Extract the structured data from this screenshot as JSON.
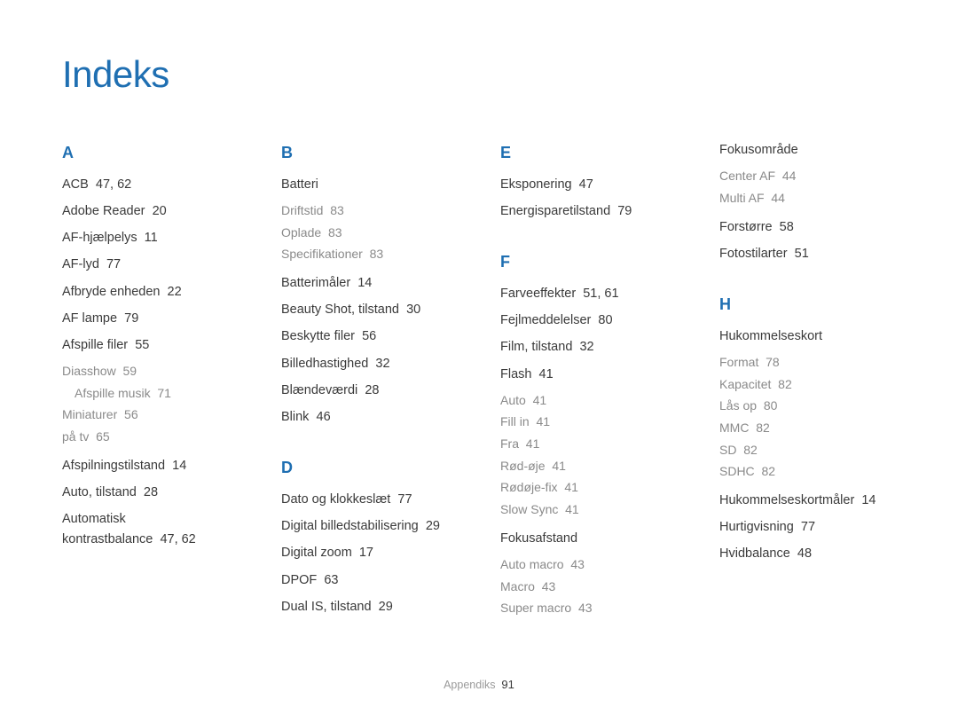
{
  "title": "Indeks",
  "footer": {
    "section": "Appendiks",
    "page": "91"
  },
  "columns": [
    [
      {
        "type": "letter",
        "text": "A"
      },
      {
        "type": "entry",
        "term": "ACB",
        "pages": "47, 62"
      },
      {
        "type": "entry",
        "term": "Adobe Reader",
        "pages": "20"
      },
      {
        "type": "entry",
        "term": "AF-hjælpelys",
        "pages": "11"
      },
      {
        "type": "entry",
        "term": "AF-lyd",
        "pages": "77"
      },
      {
        "type": "entry",
        "term": "Afbryde enheden",
        "pages": "22"
      },
      {
        "type": "entry",
        "term": "AF lampe",
        "pages": "79"
      },
      {
        "type": "entry",
        "term": "Afspille filer",
        "pages": "55"
      },
      {
        "type": "sub",
        "term": "Diasshow",
        "pages": "59",
        "indent": 0
      },
      {
        "type": "sub",
        "term": "Afspille musik",
        "pages": "71",
        "indent": 1
      },
      {
        "type": "sub",
        "term": "Miniaturer",
        "pages": "56",
        "indent": 0
      },
      {
        "type": "sub",
        "term": "på tv",
        "pages": "65",
        "indent": 0
      },
      {
        "type": "entry",
        "term": "Afspilningstilstand",
        "pages": "14",
        "topgap": true
      },
      {
        "type": "entry",
        "term": "Auto, tilstand",
        "pages": "28"
      },
      {
        "type": "entry",
        "term": "Automatisk kontrastbalance",
        "pages": "47, 62"
      }
    ],
    [
      {
        "type": "letter",
        "text": "B"
      },
      {
        "type": "entry",
        "term": "Batteri",
        "pages": ""
      },
      {
        "type": "sub",
        "term": "Driftstid",
        "pages": "83"
      },
      {
        "type": "sub",
        "term": "Oplade",
        "pages": "83"
      },
      {
        "type": "sub",
        "term": "Specifikationer",
        "pages": "83"
      },
      {
        "type": "entry",
        "term": "Batterimåler",
        "pages": "14",
        "topgap": true
      },
      {
        "type": "entry",
        "term": "Beauty Shot, tilstand",
        "pages": "30"
      },
      {
        "type": "entry",
        "term": "Beskytte filer",
        "pages": "56"
      },
      {
        "type": "entry",
        "term": "Billedhastighed",
        "pages": "32"
      },
      {
        "type": "entry",
        "term": "Blændeværdi",
        "pages": "28"
      },
      {
        "type": "entry",
        "term": "Blink",
        "pages": "46"
      },
      {
        "type": "gap"
      },
      {
        "type": "letter",
        "text": "D"
      },
      {
        "type": "entry",
        "term": "Dato og klokkeslæt",
        "pages": "77"
      },
      {
        "type": "entry",
        "term": "Digital billedstabilisering",
        "pages": "29"
      },
      {
        "type": "entry",
        "term": "Digital zoom",
        "pages": "17"
      },
      {
        "type": "entry",
        "term": "DPOF",
        "pages": "63"
      },
      {
        "type": "entry",
        "term": "Dual IS, tilstand",
        "pages": "29"
      }
    ],
    [
      {
        "type": "letter",
        "text": "E"
      },
      {
        "type": "entry",
        "term": "Eksponering",
        "pages": "47"
      },
      {
        "type": "entry",
        "term": "Energisparetilstand",
        "pages": "79"
      },
      {
        "type": "gap"
      },
      {
        "type": "letter",
        "text": "F"
      },
      {
        "type": "entry",
        "term": "Farveeffekter",
        "pages": "51, 61"
      },
      {
        "type": "entry",
        "term": "Fejlmeddelelser",
        "pages": "80"
      },
      {
        "type": "entry",
        "term": "Film, tilstand",
        "pages": "32"
      },
      {
        "type": "entry",
        "term": "Flash",
        "pages": "41"
      },
      {
        "type": "sub",
        "term": "Auto",
        "pages": "41"
      },
      {
        "type": "sub",
        "term": "Fill in",
        "pages": "41"
      },
      {
        "type": "sub",
        "term": "Fra",
        "pages": "41"
      },
      {
        "type": "sub",
        "term": "Rød-øje",
        "pages": "41"
      },
      {
        "type": "sub",
        "term": "Rødøje-fix",
        "pages": "41"
      },
      {
        "type": "sub",
        "term": "Slow Sync",
        "pages": "41"
      },
      {
        "type": "entry",
        "term": "Fokusafstand",
        "pages": "",
        "topgap": true
      },
      {
        "type": "sub",
        "term": "Auto macro",
        "pages": "43"
      },
      {
        "type": "sub",
        "term": "Macro",
        "pages": "43"
      },
      {
        "type": "sub",
        "term": "Super macro",
        "pages": "43"
      }
    ],
    [
      {
        "type": "entry",
        "term": "Fokusområde",
        "pages": ""
      },
      {
        "type": "sub",
        "term": "Center AF",
        "pages": "44"
      },
      {
        "type": "sub",
        "term": "Multi AF",
        "pages": "44"
      },
      {
        "type": "entry",
        "term": "Forstørre",
        "pages": "58",
        "topgap": true
      },
      {
        "type": "entry",
        "term": "Fotostilarter",
        "pages": "51"
      },
      {
        "type": "gap"
      },
      {
        "type": "letter",
        "text": "H"
      },
      {
        "type": "entry",
        "term": "Hukommelseskort",
        "pages": ""
      },
      {
        "type": "sub",
        "term": "Format",
        "pages": "78"
      },
      {
        "type": "sub",
        "term": "Kapacitet",
        "pages": "82"
      },
      {
        "type": "sub",
        "term": "Lås op",
        "pages": "80"
      },
      {
        "type": "sub",
        "term": "MMC",
        "pages": "82"
      },
      {
        "type": "sub",
        "term": "SD",
        "pages": "82"
      },
      {
        "type": "sub",
        "term": "SDHC",
        "pages": "82"
      },
      {
        "type": "entry",
        "term": "Hukommelseskortmåler",
        "pages": "14",
        "topgap": true
      },
      {
        "type": "entry",
        "term": "Hurtigvisning",
        "pages": "77"
      },
      {
        "type": "entry",
        "term": "Hvidbalance",
        "pages": "48"
      }
    ]
  ]
}
